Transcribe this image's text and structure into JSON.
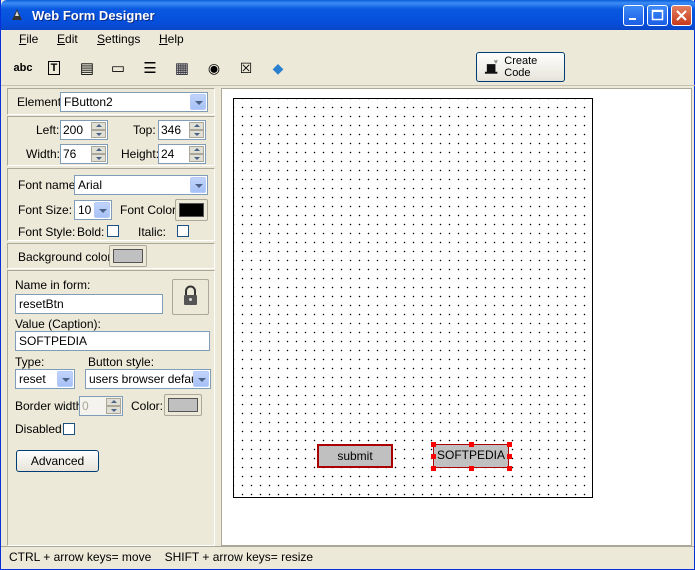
{
  "window": {
    "title": "Web Form Designer"
  },
  "menu": [
    {
      "label": "File",
      "accel": "F",
      "rest": "ile"
    },
    {
      "label": "Edit",
      "accel": "E",
      "rest": "dit"
    },
    {
      "label": "Settings",
      "accel": "S",
      "rest": "ettings"
    },
    {
      "label": "Help",
      "accel": "H",
      "rest": "elp"
    }
  ],
  "toolbar": {
    "tools": [
      {
        "name": "label-tool",
        "glyph": "abc"
      },
      {
        "name": "textbox-tool",
        "glyph": "T"
      },
      {
        "name": "textarea-tool",
        "glyph": "▤"
      },
      {
        "name": "button-tool",
        "glyph": "▭"
      },
      {
        "name": "list-tool",
        "glyph": "☰"
      },
      {
        "name": "select-tool",
        "glyph": "▦"
      },
      {
        "name": "radio-tool",
        "glyph": "◉"
      },
      {
        "name": "checkbox-tool",
        "glyph": "☒"
      },
      {
        "name": "image-tool",
        "glyph": "◆"
      }
    ],
    "create_code": "Create Code"
  },
  "props": {
    "element_label": "Element:",
    "element_value": "FButton2",
    "left_label": "Left:",
    "left_value": "200",
    "top_label": "Top:",
    "top_value": "346",
    "width_label": "Width:",
    "width_value": "76",
    "height_label": "Height:",
    "height_value": "24",
    "font_name_label": "Font name:",
    "font_name_value": "Arial",
    "font_size_label": "Font Size:",
    "font_size_value": "10",
    "font_color_label": "Font Color:",
    "font_color": "#000000",
    "font_style_label": "Font Style:",
    "bold_label": "Bold:",
    "italic_label": "Italic:",
    "bg_color_label": "Background color:",
    "bg_color": "#c0c0c0",
    "name_label": "Name in form:",
    "name_value": "resetBtn",
    "value_label": "Value (Caption):",
    "value_value": "SOFTPEDIA",
    "type_label": "Type:",
    "type_value": "reset",
    "button_style_label": "Button style:",
    "button_style_value": "users browser default",
    "border_width_label": "Border width:",
    "border_width_value": "0",
    "color_label": "Color:",
    "border_color": "#c0c0c0",
    "disabled_label": "Disabled",
    "advanced_label": "Advanced"
  },
  "canvas": {
    "buttons": [
      {
        "name": "submit-button-control",
        "label": "submit",
        "selected": false
      },
      {
        "name": "softpedia-button-control",
        "label": "SOFTPEDIA",
        "selected": true
      }
    ]
  },
  "status": {
    "text": "CTRL + arrow keys= move    SHIFT + arrow keys= resize"
  }
}
